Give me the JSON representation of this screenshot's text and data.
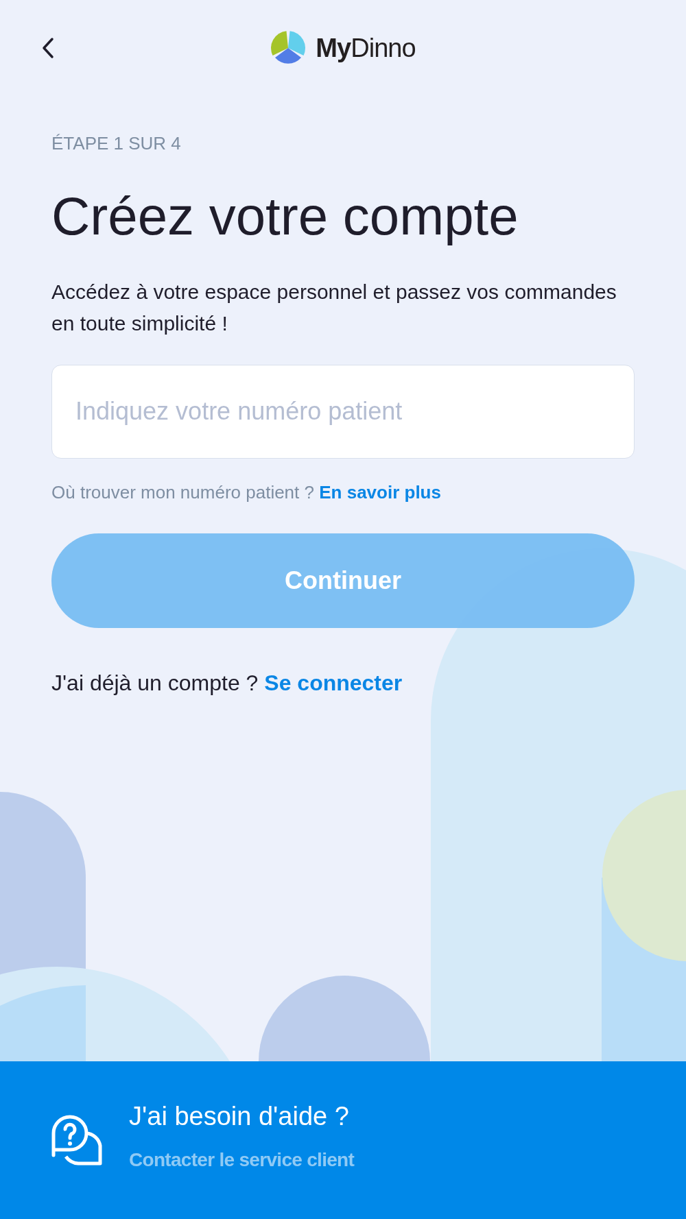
{
  "header": {
    "logo_text": "**My**Dinno"
  },
  "step": "ÉTAPE 1 SUR 4",
  "title": "Créez votre compte",
  "intro": "Accédez à votre espace personnel et passez vos commandes en toute simplicité !",
  "patient_field": {
    "placeholder": "Indiquez votre numéro patient"
  },
  "field_help": {
    "text": "Où trouver mon numéro patient ?",
    "link": "En savoir plus"
  },
  "continue_button": {
    "label": "Continuer",
    "disabled": true
  },
  "login_prompt": {
    "text": "J'ai déjà un compte ?",
    "link": "Se connecter"
  },
  "footer": {
    "title": "J'ai besoin d'aide ?",
    "link": "Contacter le service client"
  }
}
